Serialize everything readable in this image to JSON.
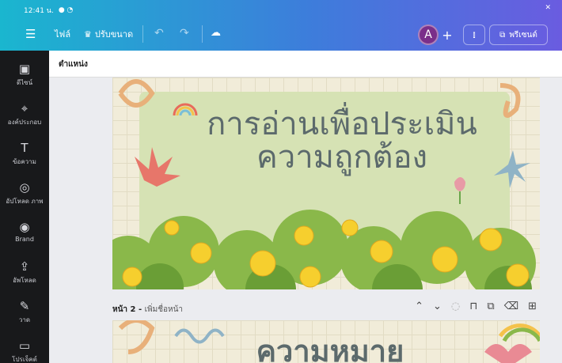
{
  "status": {
    "time": "12:41 น."
  },
  "toolbar": {
    "file_label": "ไฟล์",
    "resize_label": "ปรับขนาด",
    "avatar_initial": "A",
    "present_label": "พรีเซนต์"
  },
  "sidebar": {
    "items": [
      {
        "label": "ดีไซน์",
        "icon": "design-icon"
      },
      {
        "label": "องค์ประกอบ",
        "icon": "elements-icon"
      },
      {
        "label": "ข้อความ",
        "icon": "text-icon"
      },
      {
        "label": "อัปโหลด ภาพ",
        "icon": "camera-icon"
      },
      {
        "label": "Brand",
        "icon": "brand-icon"
      },
      {
        "label": "อัพโหลด",
        "icon": "upload-icon"
      },
      {
        "label": "วาด",
        "icon": "draw-icon"
      },
      {
        "label": "โปรเจ็คต์",
        "icon": "folder-icon"
      }
    ]
  },
  "editor": {
    "position_label": "ตำแหน่ง"
  },
  "slide1": {
    "title_line1": "การอ่านเพื่อประเมิน",
    "title_line2": "ความถูกต้อง"
  },
  "page2": {
    "label_prefix": "หน้า 2 - ",
    "add_title": "เพิ่มชื่อหน้า"
  },
  "slide2": {
    "title": "ความหมาย"
  }
}
